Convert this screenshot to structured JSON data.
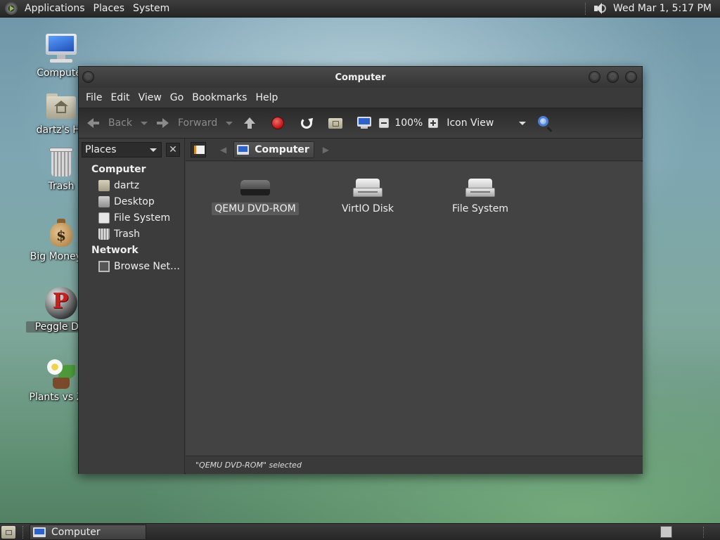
{
  "top_panel": {
    "menus": [
      "Applications",
      "Places",
      "System"
    ],
    "clock": "Wed Mar 1,  5:17 PM"
  },
  "desktop_icons": [
    {
      "label": "Computer",
      "icon": "computer-icon"
    },
    {
      "label": "dartz's Ho",
      "icon": "home-folder-icon"
    },
    {
      "label": "Trash",
      "icon": "trash-icon"
    },
    {
      "label": "Big Money D",
      "icon": "money-bag-icon"
    },
    {
      "label": "Peggle Del",
      "icon": "peggle-icon"
    },
    {
      "label": "Plants vs Zor",
      "icon": "plants-vs-zombies-icon"
    }
  ],
  "window": {
    "title": "Computer",
    "menu": [
      "File",
      "Edit",
      "View",
      "Go",
      "Bookmarks",
      "Help"
    ],
    "toolbar": {
      "back_label": "Back",
      "forward_label": "Forward",
      "zoom_level": "100%",
      "view_mode": "Icon View"
    },
    "sidebar": {
      "selector": "Places",
      "close_symbol": "✕",
      "sections": [
        {
          "title": "Computer",
          "items": [
            {
              "label": "dartz",
              "icon": "home-folder-icon"
            },
            {
              "label": "Desktop",
              "icon": "desktop-icon"
            },
            {
              "label": "File System",
              "icon": "filesystem-icon"
            },
            {
              "label": "Trash",
              "icon": "trash-icon"
            }
          ]
        },
        {
          "title": "Network",
          "items": [
            {
              "label": "Browse Net…",
              "icon": "network-icon"
            }
          ]
        }
      ]
    },
    "location": {
      "crumb": "Computer"
    },
    "files": [
      {
        "name": "QEMU DVD-ROM",
        "icon": "dvd-drive-icon",
        "selected": true
      },
      {
        "name": "VirtIO Disk",
        "icon": "hard-disk-icon",
        "selected": false
      },
      {
        "name": "File System",
        "icon": "hard-disk-icon",
        "selected": false
      }
    ],
    "status": "\"QEMU DVD-ROM\" selected"
  },
  "bottom_panel": {
    "task_label": "Computer"
  }
}
